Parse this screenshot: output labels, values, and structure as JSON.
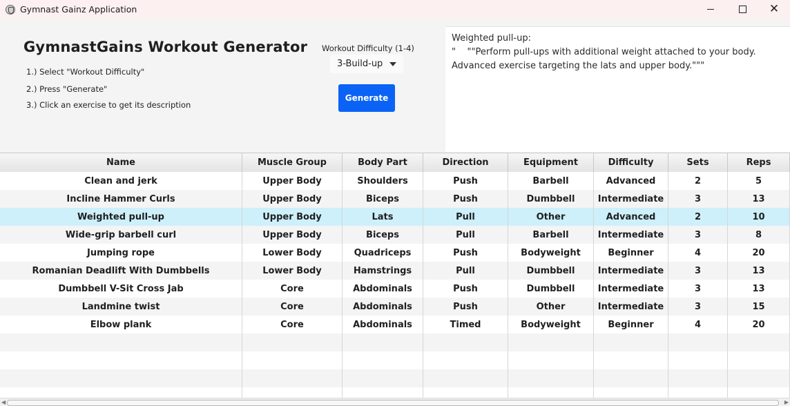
{
  "window": {
    "title": "Gymnast Gainz Application"
  },
  "header": {
    "title": "GymnastGains Workout Generator",
    "steps": [
      "1.) Select \"Workout Difficulty\"",
      "2.) Press \"Generate\"",
      "3.) Click an exercise to get its description"
    ]
  },
  "difficulty": {
    "label": "Workout Difficulty (1-4)",
    "selected": "3-Build-up"
  },
  "generate_label": "Generate",
  "description": {
    "text": "Weighted pull-up:\n\"    \"\"Perform pull-ups with additional weight attached to your body.\nAdvanced exercise targeting the lats and upper body.\"\"\""
  },
  "table": {
    "columns": [
      "Name",
      "Muscle Group",
      "Body Part",
      "Direction",
      "Equipment",
      "Difficulty",
      "Sets",
      "Reps"
    ],
    "selected_row": 2,
    "rows": [
      [
        "Clean and jerk",
        "Upper Body",
        "Shoulders",
        "Push",
        "Barbell",
        "Advanced",
        "2",
        "5"
      ],
      [
        "Incline Hammer Curls",
        "Upper Body",
        "Biceps",
        "Push",
        "Dumbbell",
        "Intermediate",
        "3",
        "13"
      ],
      [
        "Weighted pull-up",
        "Upper Body",
        "Lats",
        "Pull",
        "Other",
        "Advanced",
        "2",
        "10"
      ],
      [
        "Wide-grip barbell curl",
        "Upper Body",
        "Biceps",
        "Pull",
        "Barbell",
        "Intermediate",
        "3",
        "8"
      ],
      [
        "Jumping rope",
        "Lower Body",
        "Quadriceps",
        "Push",
        "Bodyweight",
        "Beginner",
        "4",
        "20"
      ],
      [
        "Romanian Deadlift With Dumbbells",
        "Lower Body",
        "Hamstrings",
        "Pull",
        "Dumbbell",
        "Intermediate",
        "3",
        "13"
      ],
      [
        "Dumbbell V-Sit Cross Jab",
        "Core",
        "Abdominals",
        "Push",
        "Dumbbell",
        "Intermediate",
        "3",
        "13"
      ],
      [
        "Landmine twist",
        "Core",
        "Abdominals",
        "Push",
        "Other",
        "Intermediate",
        "3",
        "15"
      ],
      [
        "Elbow plank",
        "Core",
        "Abdominals",
        "Timed",
        "Bodyweight",
        "Beginner",
        "4",
        "20"
      ]
    ],
    "empty_rows": 4
  }
}
